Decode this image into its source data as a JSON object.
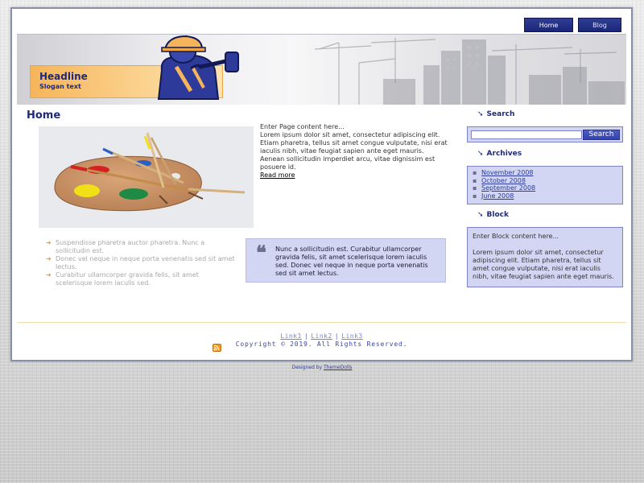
{
  "nav": {
    "home_label": "Home",
    "blog_label": "Blog"
  },
  "header": {
    "headline": "Headline",
    "slogan": "Slogan text"
  },
  "main": {
    "title": "Home",
    "intro_lead": "Enter Page content here...",
    "intro_body": "Lorem ipsum dolor sit amet, consectetur adipiscing elit. Etiam pharetra, tellus sit amet congue vulputate, nisi erat iaculis nibh, vitae feugiat sapien ante eget mauris. Aenean sollicitudin imperdiet arcu, vitae dignissim est posuere id.",
    "read_more": "Read more",
    "bullets": [
      "Suspendisse pharetra auctor pharetra. Nunc a sollicitudin est.",
      "Donec vel neque in neque porta venenatis sed sit amet lectus.",
      "Curabitur ullamcorper gravida felis, sit amet scelerisque lorem iaculis sed."
    ],
    "quote_mark": "❝",
    "quote": "Nunc a sollicitudin est. Curabitur ullamcorper gravida felis, sit amet scelerisque lorem iaculis sed. Donec vel neque in neque porta venenatis sed sit amet lectus."
  },
  "sidebar": {
    "search_heading": "Search",
    "search_placeholder": "",
    "search_button": "Search",
    "archives_heading": "Archives",
    "archives": [
      "November 2008",
      "October 2008",
      "September 2008",
      "June 2008"
    ],
    "block_heading": "Block",
    "block_lead": "Enter Block content here...",
    "block_body": "Lorem ipsum dolor sit amet, consectetur adipiscing elit. Etiam pharetra, tellus sit amet congue vulputate, nisi erat iaculis nibh, vitae feugiat sapien ante eget mauris."
  },
  "footer": {
    "links": [
      "Link1",
      "Link2",
      "Link3"
    ],
    "separator": "|",
    "copyright": "Copyright © 2019. All Rights Reserved.",
    "designed_by_prefix": "Designed by ",
    "designed_by_link": "ThemeDolls"
  },
  "icons": {
    "heading_arrow": "arrow-down-right-icon",
    "bullet_arrow": "arrow-right-icon",
    "archive_bullet": "dot-icon",
    "feed": "rss-icon"
  },
  "colors": {
    "brand_navy": "#1f2a76",
    "accent_orange": "#f6b55b",
    "panel_lavender": "#d3d6f2"
  }
}
